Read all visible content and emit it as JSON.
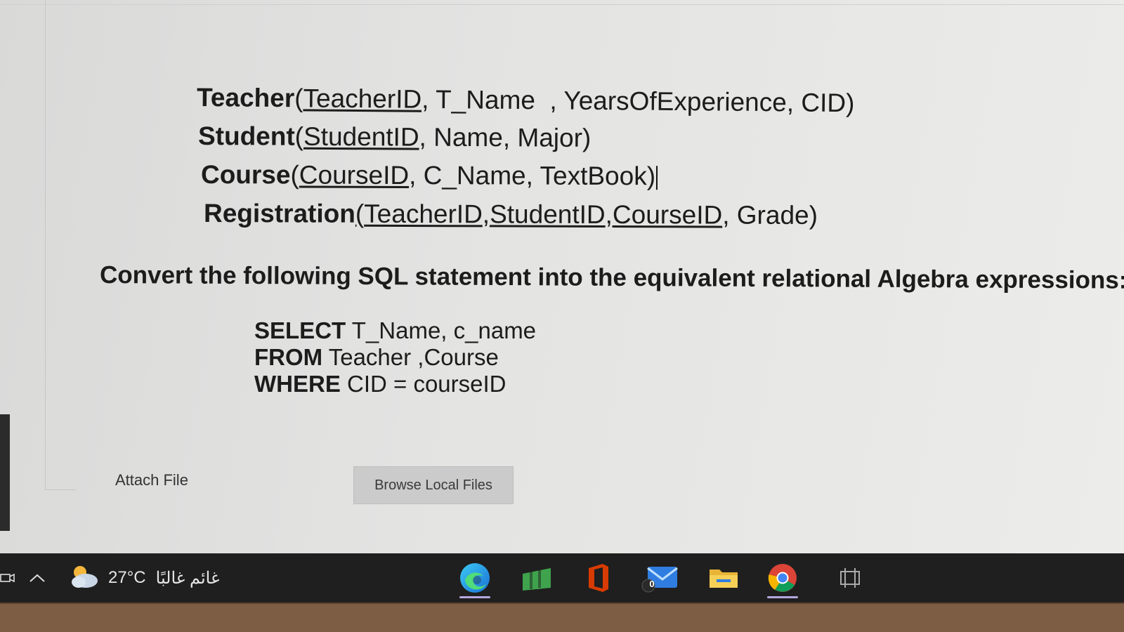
{
  "schema": {
    "teacher": {
      "name": "Teacher",
      "open": "(",
      "key": "TeacherID",
      "rest": ", T_Name  , YearsOfExperience, CID)"
    },
    "student": {
      "name": "Student",
      "open": "(",
      "key": "StudentID",
      "rest": ", Name, Major)"
    },
    "course": {
      "name": "Course",
      "open": "(",
      "key": "CourseID",
      "rest": ", C_Name, TextBook)"
    },
    "registration": {
      "name": "Registration",
      "open": "(",
      "key1": "TeacherID",
      "key2": "StudentID",
      "key3": "CourseID",
      "sep": ",",
      "rest": ", Grade)"
    }
  },
  "question": "Convert the following SQL statement into the equivalent relational Algebra expressions:",
  "sql": {
    "select_kw": "SELECT",
    "select_rest": " T_Name, c_name",
    "from_kw": "FROM",
    "from_rest": " Teacher ,Course",
    "where_kw": "WHERE",
    "where_rest": " CID = courseID"
  },
  "attach": {
    "label": "Attach File",
    "button": "Browse Local Files"
  },
  "taskbar": {
    "weather_temp": "27°C",
    "weather_desc": "غائم غالبًا",
    "mail_badge": "0",
    "icons": [
      "meet-now-icon",
      "chevron-up-icon",
      "weather-cloud-icon",
      "edge-icon",
      "spreadsheet-app-icon",
      "office-icon",
      "mail-icon",
      "file-explorer-icon",
      "chrome-icon",
      "task-view-icon"
    ],
    "colors": {
      "taskbar_bg": "#1f1f1f",
      "active_indicator": "#b5a7e0"
    }
  }
}
